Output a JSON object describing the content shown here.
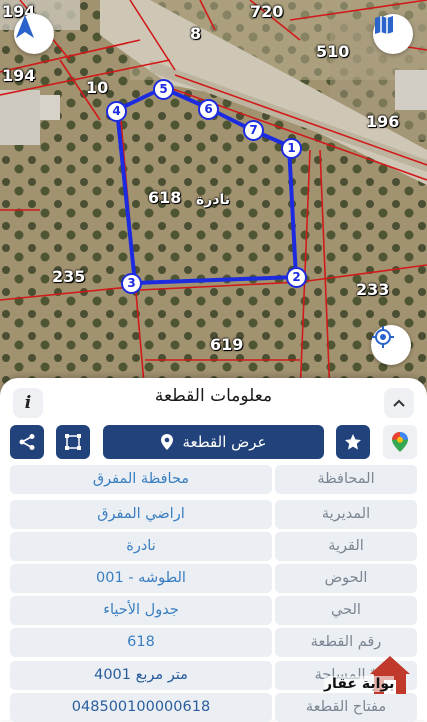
{
  "map": {
    "numbers": {
      "n194a": "194",
      "n720": "720",
      "n8": "8",
      "n510": "510",
      "n194b": "194",
      "n10": "10",
      "n196": "196",
      "n618": "618",
      "n235": "235",
      "n233": "233",
      "n619": "619"
    },
    "village_label": "نادرة",
    "vertices": [
      "1",
      "2",
      "3",
      "4",
      "5",
      "6",
      "7"
    ]
  },
  "panel": {
    "title": "معلومات القطعة",
    "info_icon": "i",
    "show_plot_label": "عرض القطعة",
    "rows": [
      {
        "label": "المحافظة",
        "value": "محافظة المفرق"
      },
      {
        "label": "المديرية",
        "value": "اراضي المفرق"
      },
      {
        "label": "القرية",
        "value": "نادرة"
      },
      {
        "label": "الحوض",
        "value": "الطوشه - 001"
      },
      {
        "label": "الحي",
        "value": "جدول الأحياء"
      },
      {
        "label": "رقم القطعة",
        "value": "618"
      },
      {
        "label": "المساحة *",
        "value": "4001 متر مربع"
      },
      {
        "label": "مفتاح القطعة",
        "value": "048500100000618"
      }
    ]
  },
  "watermark": {
    "text": "بوابة عقار"
  },
  "colors": {
    "primary": "#21427a",
    "boundary": "#1d2be0",
    "parcel_lines": "#d11a1a",
    "value_text": "#3a7ec0"
  }
}
